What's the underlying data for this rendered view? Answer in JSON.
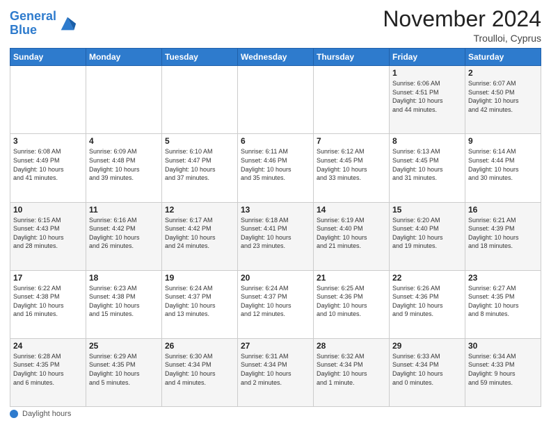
{
  "logo": {
    "line1": "General",
    "line2": "Blue"
  },
  "title": "November 2024",
  "location": "Troulloi, Cyprus",
  "days_header": [
    "Sunday",
    "Monday",
    "Tuesday",
    "Wednesday",
    "Thursday",
    "Friday",
    "Saturday"
  ],
  "footer": {
    "daylight_label": "Daylight hours"
  },
  "weeks": [
    [
      {
        "day": "",
        "info": ""
      },
      {
        "day": "",
        "info": ""
      },
      {
        "day": "",
        "info": ""
      },
      {
        "day": "",
        "info": ""
      },
      {
        "day": "",
        "info": ""
      },
      {
        "day": "1",
        "info": "Sunrise: 6:06 AM\nSunset: 4:51 PM\nDaylight: 10 hours\nand 44 minutes."
      },
      {
        "day": "2",
        "info": "Sunrise: 6:07 AM\nSunset: 4:50 PM\nDaylight: 10 hours\nand 42 minutes."
      }
    ],
    [
      {
        "day": "3",
        "info": "Sunrise: 6:08 AM\nSunset: 4:49 PM\nDaylight: 10 hours\nand 41 minutes."
      },
      {
        "day": "4",
        "info": "Sunrise: 6:09 AM\nSunset: 4:48 PM\nDaylight: 10 hours\nand 39 minutes."
      },
      {
        "day": "5",
        "info": "Sunrise: 6:10 AM\nSunset: 4:47 PM\nDaylight: 10 hours\nand 37 minutes."
      },
      {
        "day": "6",
        "info": "Sunrise: 6:11 AM\nSunset: 4:46 PM\nDaylight: 10 hours\nand 35 minutes."
      },
      {
        "day": "7",
        "info": "Sunrise: 6:12 AM\nSunset: 4:45 PM\nDaylight: 10 hours\nand 33 minutes."
      },
      {
        "day": "8",
        "info": "Sunrise: 6:13 AM\nSunset: 4:45 PM\nDaylight: 10 hours\nand 31 minutes."
      },
      {
        "day": "9",
        "info": "Sunrise: 6:14 AM\nSunset: 4:44 PM\nDaylight: 10 hours\nand 30 minutes."
      }
    ],
    [
      {
        "day": "10",
        "info": "Sunrise: 6:15 AM\nSunset: 4:43 PM\nDaylight: 10 hours\nand 28 minutes."
      },
      {
        "day": "11",
        "info": "Sunrise: 6:16 AM\nSunset: 4:42 PM\nDaylight: 10 hours\nand 26 minutes."
      },
      {
        "day": "12",
        "info": "Sunrise: 6:17 AM\nSunset: 4:42 PM\nDaylight: 10 hours\nand 24 minutes."
      },
      {
        "day": "13",
        "info": "Sunrise: 6:18 AM\nSunset: 4:41 PM\nDaylight: 10 hours\nand 23 minutes."
      },
      {
        "day": "14",
        "info": "Sunrise: 6:19 AM\nSunset: 4:40 PM\nDaylight: 10 hours\nand 21 minutes."
      },
      {
        "day": "15",
        "info": "Sunrise: 6:20 AM\nSunset: 4:40 PM\nDaylight: 10 hours\nand 19 minutes."
      },
      {
        "day": "16",
        "info": "Sunrise: 6:21 AM\nSunset: 4:39 PM\nDaylight: 10 hours\nand 18 minutes."
      }
    ],
    [
      {
        "day": "17",
        "info": "Sunrise: 6:22 AM\nSunset: 4:38 PM\nDaylight: 10 hours\nand 16 minutes."
      },
      {
        "day": "18",
        "info": "Sunrise: 6:23 AM\nSunset: 4:38 PM\nDaylight: 10 hours\nand 15 minutes."
      },
      {
        "day": "19",
        "info": "Sunrise: 6:24 AM\nSunset: 4:37 PM\nDaylight: 10 hours\nand 13 minutes."
      },
      {
        "day": "20",
        "info": "Sunrise: 6:24 AM\nSunset: 4:37 PM\nDaylight: 10 hours\nand 12 minutes."
      },
      {
        "day": "21",
        "info": "Sunrise: 6:25 AM\nSunset: 4:36 PM\nDaylight: 10 hours\nand 10 minutes."
      },
      {
        "day": "22",
        "info": "Sunrise: 6:26 AM\nSunset: 4:36 PM\nDaylight: 10 hours\nand 9 minutes."
      },
      {
        "day": "23",
        "info": "Sunrise: 6:27 AM\nSunset: 4:35 PM\nDaylight: 10 hours\nand 8 minutes."
      }
    ],
    [
      {
        "day": "24",
        "info": "Sunrise: 6:28 AM\nSunset: 4:35 PM\nDaylight: 10 hours\nand 6 minutes."
      },
      {
        "day": "25",
        "info": "Sunrise: 6:29 AM\nSunset: 4:35 PM\nDaylight: 10 hours\nand 5 minutes."
      },
      {
        "day": "26",
        "info": "Sunrise: 6:30 AM\nSunset: 4:34 PM\nDaylight: 10 hours\nand 4 minutes."
      },
      {
        "day": "27",
        "info": "Sunrise: 6:31 AM\nSunset: 4:34 PM\nDaylight: 10 hours\nand 2 minutes."
      },
      {
        "day": "28",
        "info": "Sunrise: 6:32 AM\nSunset: 4:34 PM\nDaylight: 10 hours\nand 1 minute."
      },
      {
        "day": "29",
        "info": "Sunrise: 6:33 AM\nSunset: 4:34 PM\nDaylight: 10 hours\nand 0 minutes."
      },
      {
        "day": "30",
        "info": "Sunrise: 6:34 AM\nSunset: 4:33 PM\nDaylight: 9 hours\nand 59 minutes."
      }
    ]
  ]
}
